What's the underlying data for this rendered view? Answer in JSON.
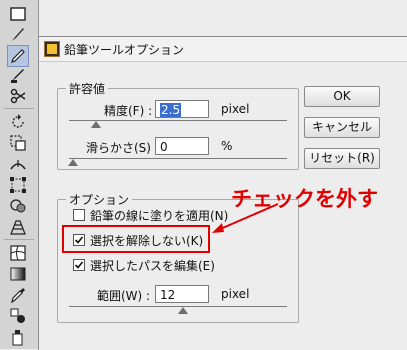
{
  "dialog": {
    "title": "鉛筆ツールオプション",
    "tolerance_group": {
      "legend": "許容値",
      "fidelity": {
        "label": "精度(F) :",
        "value": "2.5",
        "unit": "pixel"
      },
      "smoothness": {
        "label": "滑らかさ(S) :",
        "value": "0",
        "unit": "%"
      }
    },
    "options_group": {
      "legend": "オプション",
      "fill_new_strokes": {
        "label": "鉛筆の線に塗りを適用(N)",
        "checked": false
      },
      "keep_selected": {
        "label": "選択を解除しない(K)",
        "checked": true
      },
      "edit_selected_paths": {
        "label": "選択したパスを編集(E)",
        "checked": true
      },
      "within": {
        "label": "範囲(W) :",
        "value": "12",
        "unit": "pixel"
      }
    },
    "buttons": {
      "ok": "OK",
      "cancel": "キャンセル",
      "reset": "リセット(R)"
    }
  },
  "annotation": {
    "text": "チェックを外す",
    "color": "#e10000"
  },
  "toolbar": {
    "tools": [
      "rectangle-tool-icon",
      "paintbrush-tool-icon",
      "pencil-tool-icon",
      "blob-brush-tool-icon",
      "scissors-tool-icon",
      "rotate-tool-icon",
      "scale-tool-icon",
      "width-tool-icon",
      "free-transform-tool-icon",
      "shape-builder-tool-icon",
      "perspective-grid-tool-icon",
      "mesh-tool-icon",
      "gradient-tool-icon",
      "eyedropper-tool-icon",
      "blend-tool-icon",
      "symbol-sprayer-tool-icon"
    ],
    "active_tool": "pencil-tool-icon"
  }
}
